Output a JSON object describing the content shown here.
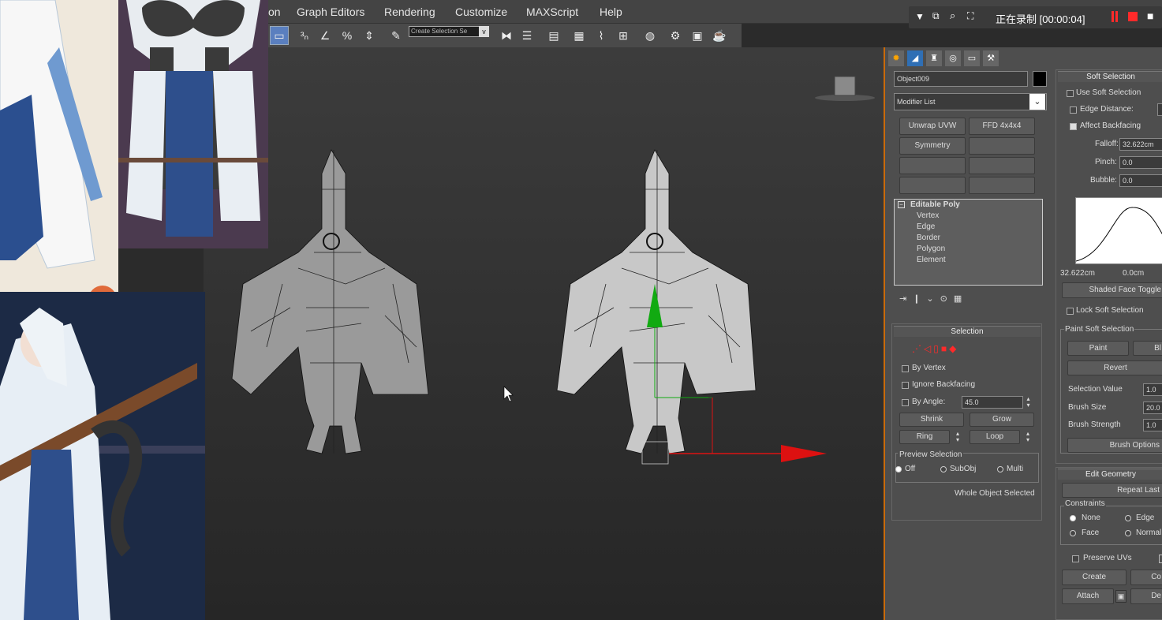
{
  "menu": [
    "on",
    "Graph Editors",
    "Rendering",
    "Customize",
    "MAXScript",
    "Help"
  ],
  "toolbar": {
    "selection_set_placeholder": "Create Selection Se"
  },
  "recording": {
    "status": "正在录制 [00:00:04]"
  },
  "colors": {
    "accent": "#c96a0a",
    "gizmo_x": "#dd1111",
    "gizmo_y": "#11aa11",
    "record": "#ff2a2a"
  },
  "modify": {
    "object_name": "Object009",
    "modifier_list": "Modifier List",
    "buttons": [
      "Unwrap UVW",
      "FFD 4x4x4",
      "Symmetry"
    ],
    "stack": {
      "root": "Editable Poly",
      "children": [
        "Vertex",
        "Edge",
        "Border",
        "Polygon",
        "Element"
      ]
    },
    "selection": {
      "title": "Selection",
      "by_vertex": "By Vertex",
      "ignore_backfacing": "Ignore Backfacing",
      "by_angle": "By Angle:",
      "angle": "45.0",
      "shrink": "Shrink",
      "grow": "Grow",
      "ring": "Ring",
      "loop": "Loop",
      "preview": "Preview Selection",
      "off": "Off",
      "subobj": "SubObj",
      "multi": "Multi",
      "status": "Whole Object Selected"
    }
  },
  "soft": {
    "title": "Soft Selection",
    "use": "Use Soft Selection",
    "edge_distance": "Edge Distance:",
    "affect_backfacing": "Affect Backfacing",
    "falloff_label": "Falloff:",
    "falloff": "32.622cm",
    "pinch_label": "Pinch:",
    "pinch": "0.0",
    "bubble_label": "Bubble:",
    "bubble": "0.0",
    "curve_left": "32.622cm",
    "curve_mid": "0.0cm",
    "shaded_toggle": "Shaded Face Toggle",
    "lock": "Lock Soft Selection",
    "paint_group": "Paint Soft Selection",
    "paint": "Paint",
    "blur": "Bl",
    "revert": "Revert",
    "selection_value_label": "Selection Value",
    "selection_value": "1.0",
    "brush_size_label": "Brush Size",
    "brush_size": "20.0",
    "brush_strength_label": "Brush Strength",
    "brush_strength": "1.0",
    "brush_options": "Brush Options"
  },
  "edit_geometry": {
    "title": "Edit Geometry",
    "repeat_last": "Repeat Last",
    "constraints": "Constraints",
    "none": "None",
    "edge": "Edge",
    "face": "Face",
    "normal": "Normal",
    "preserve_uvs": "Preserve UVs",
    "create": "Create",
    "collapse": "Co",
    "attach": "Attach",
    "detach": "De"
  }
}
